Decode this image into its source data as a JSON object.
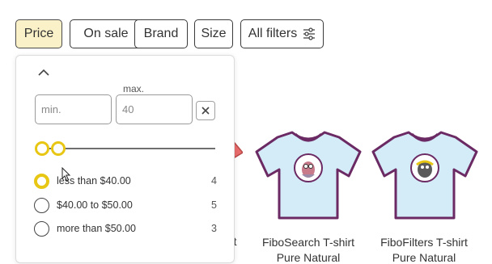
{
  "filter_bar": {
    "chips": [
      {
        "label": "Price",
        "active": true
      },
      {
        "label": "On sale",
        "active": false
      },
      {
        "label": "Brand",
        "active": false
      },
      {
        "label": "Size",
        "active": false
      },
      {
        "label": "All filters",
        "active": false,
        "icon": "sliders-icon"
      }
    ]
  },
  "price_dropdown": {
    "collapse_icon": "chevron-up-icon",
    "min": {
      "placeholder": "min.",
      "value": ""
    },
    "max": {
      "label": "max.",
      "value": "40"
    },
    "clear_icon": "close-icon",
    "options": [
      {
        "label": "less than $40.00",
        "count": "4",
        "selected": true
      },
      {
        "label": "$40.00 to $50.00",
        "count": "5",
        "selected": false
      },
      {
        "label": "more than $50.00",
        "count": "3",
        "selected": false
      }
    ]
  },
  "products": [
    {
      "partial_title": "rt"
    },
    {
      "title_line1": "FiboSearch T-shirt",
      "title_line2": "Pure Natural"
    },
    {
      "title_line1": "FiboFilters T-shirt",
      "title_line2": "Pure Natural"
    }
  ],
  "colors": {
    "accent": "#e8c614",
    "active_chip_bg": "#faf1c8",
    "tshirt_body": "#d3ecf8",
    "tshirt_outline": "#6b2a63"
  }
}
